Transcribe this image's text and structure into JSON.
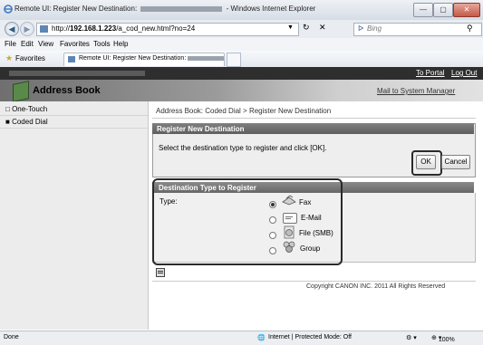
{
  "window": {
    "title": "Remote UI: Register New Destination: ",
    "title_suffix": " - Windows Internet Explorer",
    "minimize": "—",
    "maximize": "▢",
    "close": "✕"
  },
  "address_bar": {
    "url_prefix": "http://",
    "url_host": "192.168.1.223",
    "url_path": "/a_cod_new.html?no=24",
    "search_placeholder": "Bing",
    "refresh": "↻",
    "stop": "✕"
  },
  "menu": [
    "File",
    "Edit",
    "View",
    "Favorites",
    "Tools",
    "Help"
  ],
  "favorites": {
    "label": "Favorites",
    "tab_title": "Remote UI: Register New Destination: "
  },
  "portal": {
    "to_portal": "To Portal",
    "log_out": "Log Out"
  },
  "header": {
    "title": "Address Book",
    "mail_link": "Mail to System Manager"
  },
  "sidebar": {
    "items": [
      {
        "label": "One-Touch",
        "marker": "□"
      },
      {
        "label": "Coded Dial",
        "marker": "■"
      }
    ]
  },
  "main": {
    "breadcrumb": "Address Book: Coded Dial > Register New Destination",
    "register": {
      "heading": "Register New Destination",
      "instruction": "Select the destination type to register and click [OK].",
      "ok": "OK",
      "cancel": "Cancel"
    },
    "type_panel": {
      "heading": "Destination Type to Register",
      "type_label": "Type:",
      "options": [
        {
          "label": "Fax",
          "selected": true
        },
        {
          "label": "E-Mail",
          "selected": false
        },
        {
          "label": "File (SMB)",
          "selected": false
        },
        {
          "label": "Group",
          "selected": false
        }
      ]
    },
    "copyright": "Copyright CANON INC. 2011 All Rights Reserved"
  },
  "status_bar": {
    "left": "Done",
    "zone": "Internet | Protected Mode: Off",
    "zoom": "100%"
  }
}
